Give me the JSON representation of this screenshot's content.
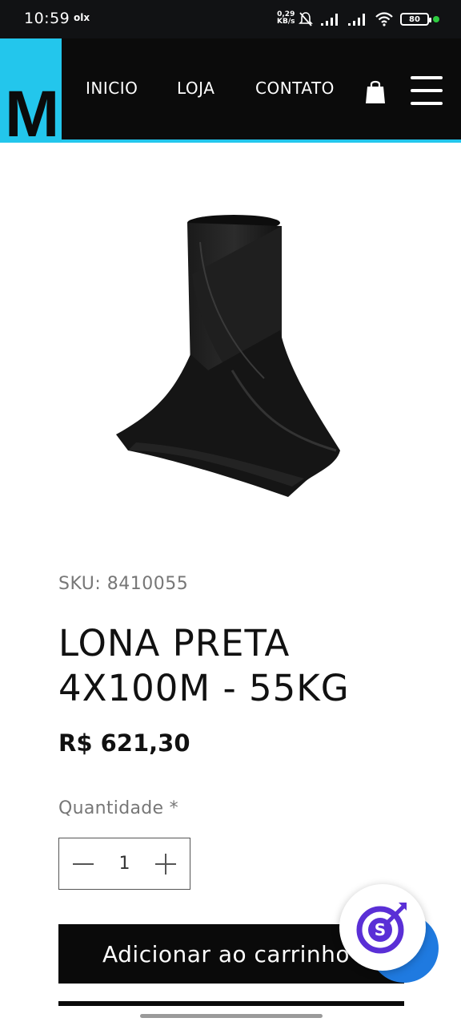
{
  "status_bar": {
    "time": "10:59",
    "app_indicator": "olx",
    "speed_value": "0,29",
    "speed_unit": "KB/s",
    "battery": "80",
    "icons": [
      "mute-icon",
      "signal-icon",
      "signal-icon",
      "wifi-icon",
      "battery-icon"
    ]
  },
  "header": {
    "logo_letter": "M",
    "nav": {
      "home": "INICIO",
      "shop": "LOJA",
      "contact": "CONTATO"
    },
    "accent_color": "#23c6ec",
    "bar_color": "#0b0b0b"
  },
  "product": {
    "image_icon": "black-plastic-roll-image",
    "sku": "SKU: 8410055",
    "title": "LONA PRETA 4X100M - 55KG",
    "price": "R$ 621,30",
    "quantity_label": "Quantidade",
    "quantity_required": "*",
    "quantity_value": "1",
    "add_to_cart": "Adicionar ao carrinho"
  },
  "floating_widget": {
    "icon": "target-s-icon",
    "colors": {
      "ring": "#5a2fd6",
      "blue": "#1f7ae0"
    }
  }
}
